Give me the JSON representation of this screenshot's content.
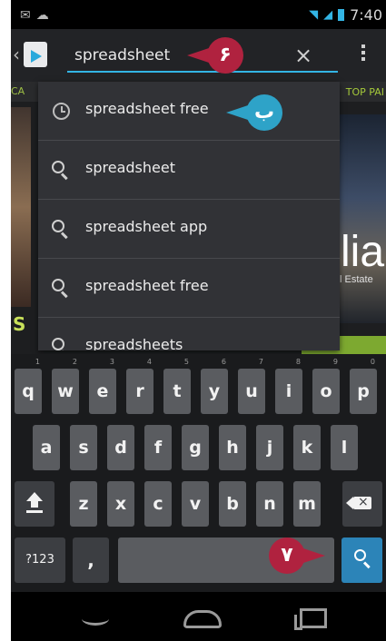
{
  "status_bar": {
    "time": "7:40"
  },
  "search": {
    "query": "spreadsheet",
    "clear_glyph": "×"
  },
  "background_store": {
    "tab_left": "CA",
    "tab_right": "TOP PAI",
    "banner_text": "lia",
    "banner_subtext": "l Estate",
    "left_letter": "S"
  },
  "suggestions": [
    {
      "text": "spreadsheet free",
      "icon": "history-clock-icon"
    },
    {
      "text": "spreadsheet",
      "icon": "search-icon"
    },
    {
      "text": "spreadsheet app",
      "icon": "search-icon"
    },
    {
      "text": "spreadsheet free",
      "icon": "search-icon"
    },
    {
      "text": "spreadsheets",
      "icon": "search-icon"
    }
  ],
  "keyboard": {
    "row1": [
      {
        "key": "q",
        "sub": "1"
      },
      {
        "key": "w",
        "sub": "2"
      },
      {
        "key": "e",
        "sub": "3"
      },
      {
        "key": "r",
        "sub": "4"
      },
      {
        "key": "t",
        "sub": "5"
      },
      {
        "key": "y",
        "sub": "6"
      },
      {
        "key": "u",
        "sub": "7"
      },
      {
        "key": "i",
        "sub": "8"
      },
      {
        "key": "o",
        "sub": "9"
      },
      {
        "key": "p",
        "sub": "0"
      }
    ],
    "row2": [
      "a",
      "s",
      "d",
      "f",
      "g",
      "h",
      "j",
      "k",
      "l"
    ],
    "row3": [
      "z",
      "x",
      "c",
      "v",
      "b",
      "n",
      "m"
    ],
    "symbols_label": "?123",
    "comma_label": ","
  },
  "callouts": {
    "one": {
      "label": "۶",
      "color": "#b0223f"
    },
    "two": {
      "label": "ب",
      "color": "#2ea3c8"
    },
    "three": {
      "label": "۷",
      "color": "#b0223f"
    }
  },
  "colors": {
    "accent": "#33b5e5",
    "search_key": "#2c84b8"
  }
}
